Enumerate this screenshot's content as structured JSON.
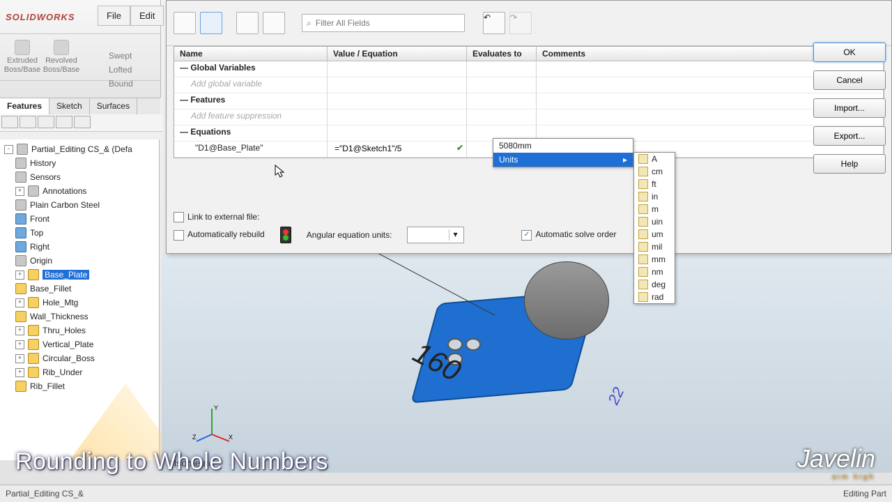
{
  "app": {
    "brand": "SOLIDWORKS"
  },
  "menu": {
    "file": "File",
    "edit": "Edit"
  },
  "commands": {
    "extruded": "Extruded Boss/Base",
    "revolved": "Revolved Boss/Base",
    "swept": "Swept",
    "lofted": "Lofted",
    "boundary": "Bound"
  },
  "tabs": {
    "features": "Features",
    "sketch": "Sketch",
    "surfaces": "Surfaces"
  },
  "tree": {
    "root": "Partial_Editing CS_&  (Defa",
    "history": "History",
    "sensors": "Sensors",
    "annotations": "Annotations",
    "material": "Plain Carbon Steel",
    "front": "Front",
    "top": "Top",
    "right": "Right",
    "origin": "Origin",
    "base_plate": "Base_Plate",
    "base_fillet": "Base_Fillet",
    "hole_mtg": "Hole_Mtg",
    "wall_thickness": "Wall_Thickness",
    "thru_holes": "Thru_Holes",
    "vertical_plate": "Vertical_Plate",
    "circular_boss": "Circular_Boss",
    "rib_under": "Rib_Under",
    "rib_fillet": "Rib_Fillet"
  },
  "dialog": {
    "filter_placeholder": "Filter All Fields",
    "cols": {
      "name": "Name",
      "value": "Value / Equation",
      "eval": "Evaluates to",
      "comments": "Comments"
    },
    "sect_globals": "— Global Variables",
    "hint_globals": "Add global variable",
    "sect_features": "— Features",
    "hint_features": "Add feature suppression",
    "sect_equations": "— Equations",
    "eq_name": "\"D1@Base_Plate\"",
    "eq_value": "=\"D1@Sketch1\"/5",
    "ac_value": "5080mm",
    "ac_units": "Units",
    "units_list": [
      "A",
      "cm",
      "ft",
      "in",
      "m",
      "uin",
      "um",
      "mil",
      "mm",
      "nm",
      "deg",
      "rad"
    ],
    "auto_rebuild": "Automatically rebuild",
    "angular_units": "Angular equation units:",
    "auto_solve": "Automatic solve order",
    "link_file": "Link to external file:",
    "buttons": {
      "ok": "OK",
      "cancel": "Cancel",
      "import": "Import...",
      "export": "Export...",
      "help": "Help"
    }
  },
  "gfx": {
    "iso": "*Isometric",
    "dim1": "160",
    "dim2": "22"
  },
  "caption": "Rounding to Whole Numbers",
  "javelin": {
    "name": "Javelin",
    "tag": "aim high"
  },
  "status": {
    "left": "Partial_Editing CS_&",
    "right": "Editing Part"
  }
}
